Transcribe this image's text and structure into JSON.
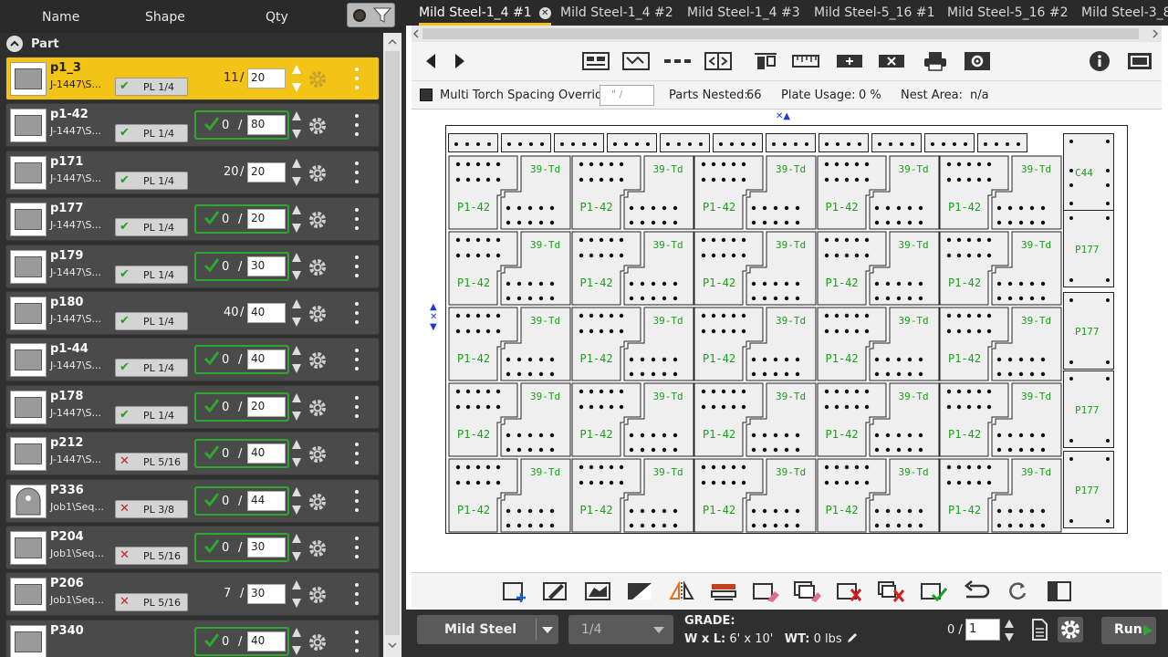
{
  "list_header": {
    "col_name": "Name",
    "col_shape": "Shape",
    "col_qty": "Qty"
  },
  "group": {
    "label": "Part"
  },
  "parts": [
    {
      "name": "p1_3",
      "job": "J-1447\\S...",
      "mat_ok": true,
      "mat_label": "PL 1/4",
      "nested": "11",
      "qty": "20",
      "qty_ok": false,
      "selected": true
    },
    {
      "name": "p1-42",
      "job": "J-1447\\S...",
      "mat_ok": true,
      "mat_label": "PL 1/4",
      "nested": "0",
      "qty": "80",
      "qty_ok": true,
      "selected": false
    },
    {
      "name": "p171",
      "job": "J-1447\\S...",
      "mat_ok": true,
      "mat_label": "PL 1/4",
      "nested": "20",
      "qty": "20",
      "qty_ok": false,
      "selected": false
    },
    {
      "name": "p177",
      "job": "J-1447\\S...",
      "mat_ok": true,
      "mat_label": "PL 1/4",
      "nested": "0",
      "qty": "20",
      "qty_ok": true,
      "selected": false
    },
    {
      "name": "p179",
      "job": "J-1447\\S...",
      "mat_ok": true,
      "mat_label": "PL 1/4",
      "nested": "0",
      "qty": "30",
      "qty_ok": true,
      "selected": false
    },
    {
      "name": "p180",
      "job": "J-1447\\S...",
      "mat_ok": true,
      "mat_label": "PL 1/4",
      "nested": "40",
      "qty": "40",
      "qty_ok": false,
      "selected": false
    },
    {
      "name": "p1-44",
      "job": "J-1447\\S...",
      "mat_ok": true,
      "mat_label": "PL 1/4",
      "nested": "0",
      "qty": "40",
      "qty_ok": true,
      "selected": false
    },
    {
      "name": "p178",
      "job": "J-1447\\S...",
      "mat_ok": true,
      "mat_label": "PL 1/4",
      "nested": "0",
      "qty": "20",
      "qty_ok": true,
      "selected": false
    },
    {
      "name": "p212",
      "job": "J-1447\\S...",
      "mat_ok": false,
      "mat_label": "PL 5/16",
      "nested": "0",
      "qty": "40",
      "qty_ok": true,
      "selected": false
    },
    {
      "name": "P336",
      "job": "Job1\\Seq...",
      "mat_ok": false,
      "mat_label": "PL 3/8",
      "nested": "0",
      "qty": "44",
      "qty_ok": true,
      "selected": false
    },
    {
      "name": "P204",
      "job": "Job1\\Seq...",
      "mat_ok": false,
      "mat_label": "PL 5/16",
      "nested": "0",
      "qty": "30",
      "qty_ok": true,
      "selected": false
    },
    {
      "name": "P206",
      "job": "Job1\\Seq...",
      "mat_ok": false,
      "mat_label": "PL 5/16",
      "nested": "7",
      "qty": "30",
      "qty_ok": false,
      "selected": false
    },
    {
      "name": "P340",
      "job": "",
      "mat_ok": false,
      "mat_label": "",
      "nested": "0",
      "qty": "40",
      "qty_ok": true,
      "selected": false
    }
  ],
  "tabs": [
    {
      "label": "Mild Steel-1_4 #1",
      "active": true
    },
    {
      "label": "Mild Steel-1_4 #2",
      "active": false
    },
    {
      "label": "Mild Steel-1_4 #3",
      "active": false
    },
    {
      "label": "Mild Steel-5_16 #1",
      "active": false
    },
    {
      "label": "Mild Steel-5_16 #2",
      "active": false
    },
    {
      "label": "Mild Steel-3_8",
      "active": false
    }
  ],
  "options": {
    "multi_torch_label": "Multi Torch Spacing Override:",
    "override_placeholder": "\" /",
    "parts_nested_label": "Parts Nested:",
    "parts_nested_value": "66",
    "plate_usage_label": "Plate Usage:",
    "plate_usage_value": "0 %",
    "nest_area_label": "Nest Area:",
    "nest_area_value": "n/a"
  },
  "nest": {
    "label_a": "39-Td",
    "label_b": "P1-42",
    "label_c": "P177",
    "label_d": "C44",
    "rows": 5,
    "cols": 5
  },
  "bottom": {
    "material": "Mild Steel",
    "thickness": "1/4",
    "grade_label": "GRADE:",
    "wl_label": "W x L:",
    "wl_value": "6' x 10'",
    "wt_label": "WT:",
    "wt_value": "0 lbs",
    "count_label": "0 /",
    "count_value": "1",
    "run_label": "Run"
  },
  "colors": {
    "accent": "#f3c316",
    "ok": "#2fa82f",
    "bad": "#d02020",
    "label": "#18a018"
  }
}
